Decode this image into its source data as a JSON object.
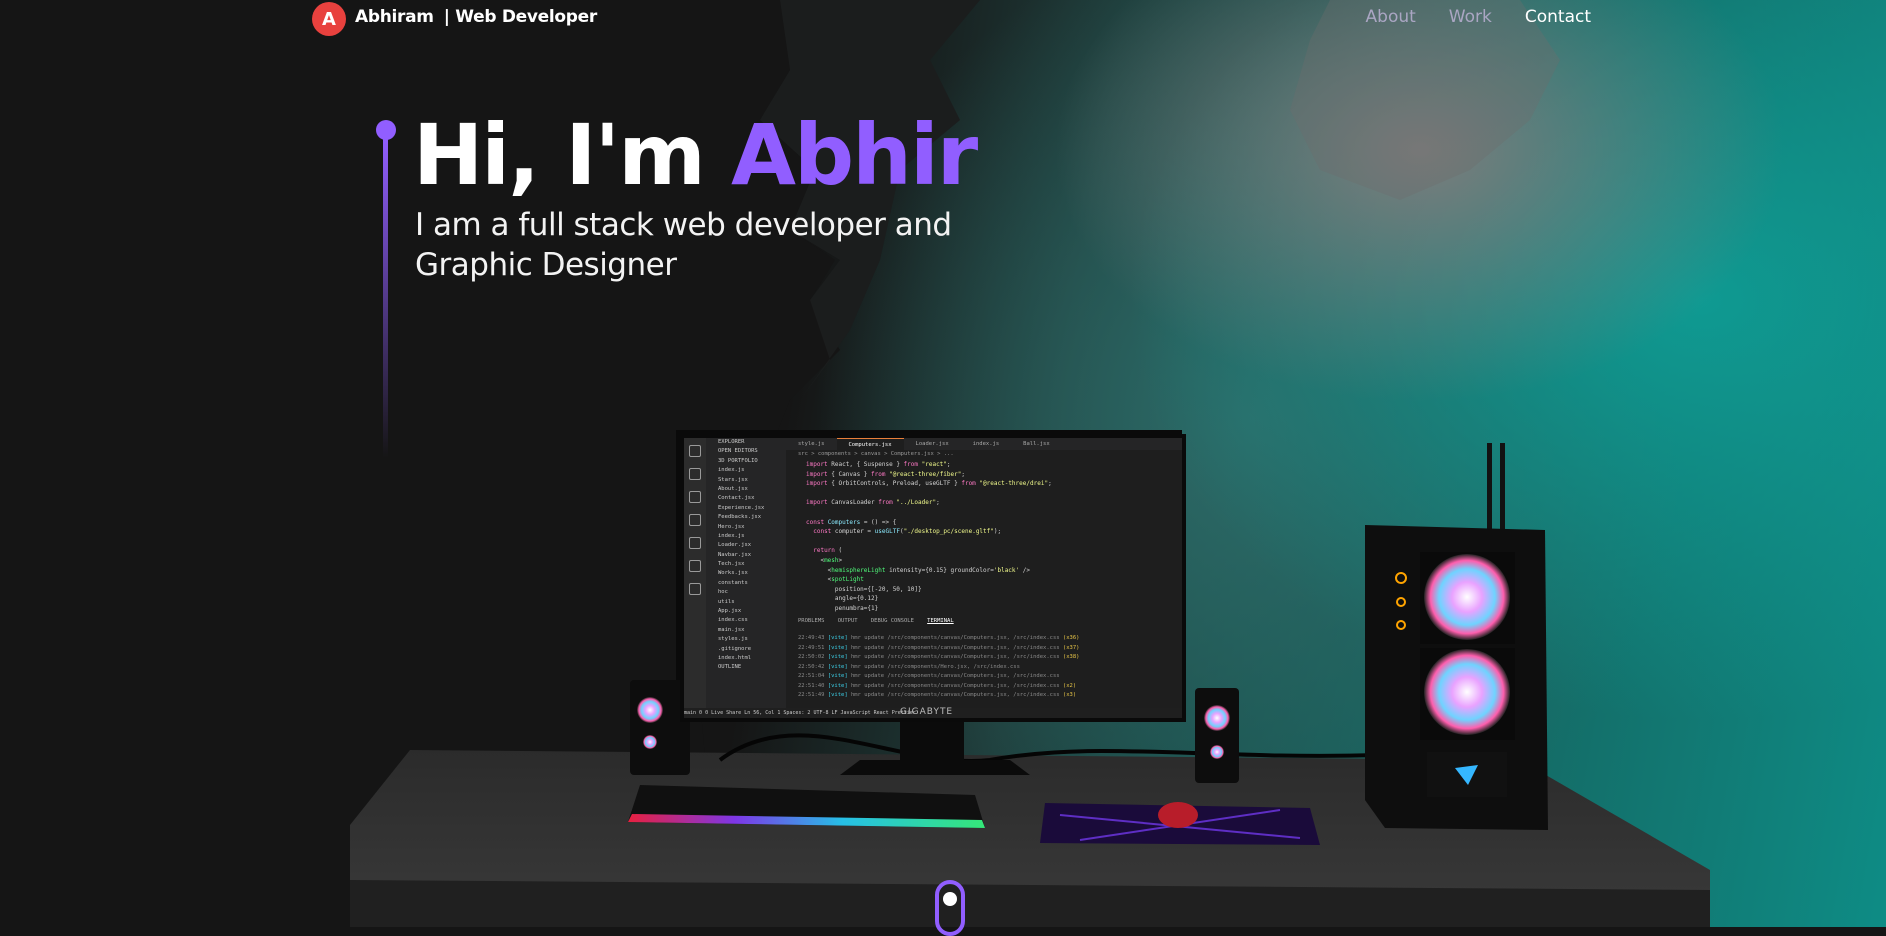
{
  "nav": {
    "logo_letter": "A",
    "brand_name": "Abhiram",
    "brand_sub": "| Web Developer",
    "links": [
      {
        "label": "About",
        "active": false
      },
      {
        "label": "Work",
        "active": false
      },
      {
        "label": "Contact",
        "active": true
      }
    ]
  },
  "hero": {
    "greeting": "Hi, I'm ",
    "name": "Abhir",
    "subtitle": "I am a full stack web developer and Graphic Designer"
  },
  "colors": {
    "accent": "#915eff",
    "logo_bg": "#e8413e",
    "background": "#151515",
    "teal": "#0e8c85"
  },
  "monitor": {
    "brand": "GIGABYTE",
    "explorer_items": [
      "EXPLORER",
      "OPEN EDITORS",
      "3D PORTFOLIO",
      "index.js",
      "Stars.jsx",
      "About.jsx",
      "Contact.jsx",
      "Experience.jsx",
      "Feedbacks.jsx",
      "Hero.jsx",
      "index.js",
      "Loader.jsx",
      "Navbar.jsx",
      "Tech.jsx",
      "Works.jsx",
      "constants",
      "hoc",
      "utils",
      "App.jsx",
      "index.css",
      "main.jsx",
      "styles.js",
      ".gitignore",
      "index.html",
      "OUTLINE"
    ],
    "tabs": [
      "style.js",
      "Computers.jsx",
      "Loader.jsx",
      "index.js",
      "Ball.jsx"
    ],
    "breadcrumb": "src > components > canvas > Computers.jsx > ...",
    "panel_tabs": [
      "PROBLEMS",
      "OUTPUT",
      "DEBUG CONSOLE",
      "TERMINAL"
    ],
    "status_bar": "main   0 0   Live Share          Ln 56, Col 1   Spaces: 2   UTF-8   LF   JavaScript React   Prettier"
  },
  "icons": {
    "scroll": "scroll-indicator-icon"
  }
}
